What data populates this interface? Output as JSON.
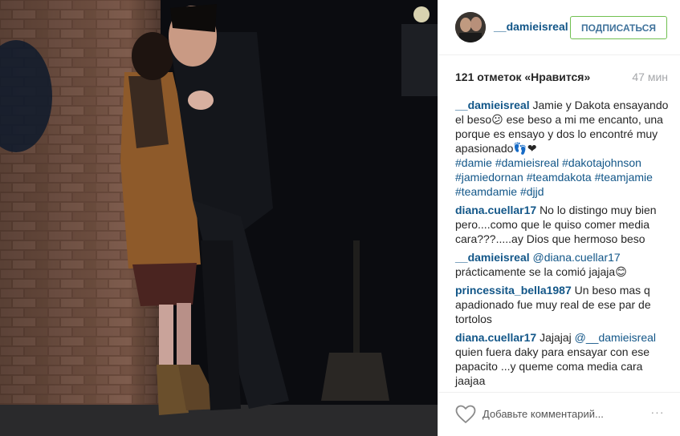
{
  "post": {
    "username": "__damieisreal",
    "follow_label": "ПОДПИСАТЬСЯ",
    "likes_text": "121 отметок «Нравится»",
    "time_ago": "47 мин",
    "caption": {
      "username": "__damieisreal",
      "text": "Jamie y Dakota ensayando el beso😕 ese beso a mi me encanto, una porque es ensayo y dos lo encontré muy apasionado👣❤",
      "tags": [
        "#damie",
        "#damieisreal",
        "#dakotajohnson",
        "#jamiedornan",
        "#teamdakota",
        "#teamjamie",
        "#teamdamie",
        "#djjd"
      ]
    },
    "comments": [
      {
        "username": "diana.cuellar17",
        "mention": "",
        "text": "No lo distingo muy bien pero....como que le quiso comer media cara???.....ay Dios que hermoso beso"
      },
      {
        "username": "__damieisreal",
        "mention": "@diana.cuellar17",
        "text": "prácticamente se la comió jajaja😊"
      },
      {
        "username": "princessita_bella1987",
        "mention": "",
        "text": "Un beso mas q apadionado fue muy real de ese par de tortolos"
      },
      {
        "username": "diana.cuellar17",
        "mention": "@__damieisreal",
        "text": "Jajajaj",
        "text_after": "quien fuera daky para ensayar con ese papacito ...y queme coma media cara jaajaa"
      }
    ],
    "comment_placeholder": "Добавьте комментарий...",
    "more_label": "···"
  },
  "colors": {
    "link_blue": "#125688",
    "follow_text": "#3f729b",
    "follow_border": "#70c050",
    "muted": "#a5a7aa"
  },
  "icons": {
    "like": "heart-outline-icon",
    "more": "ellipsis-icon"
  }
}
